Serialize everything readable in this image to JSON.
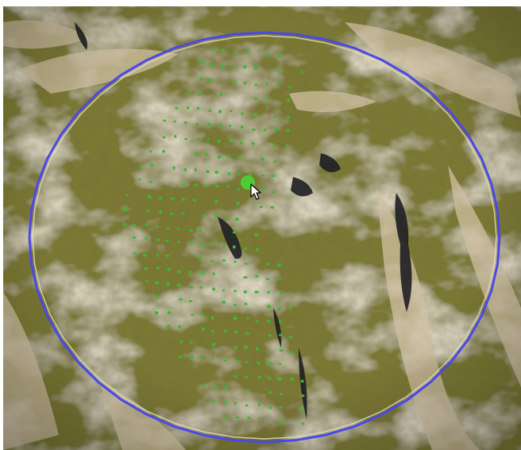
{
  "scene": {
    "view": "editor-3d-viewport",
    "content": "terrain-with-foliage-brush",
    "colors": {
      "grass": "#7d7a32",
      "grass_dark": "#5a5a22",
      "rock_light": "#c9b89c",
      "rock_dark": "#1c1c20",
      "brush_outer": "#4a48e8",
      "brush_inner": "#e6dcb4",
      "foliage_marker": "#3fb53a",
      "brush_center": "#4ccc36"
    },
    "icons": {
      "cursor": "mouse-pointer-icon",
      "brush_center": "brush-center-dot-icon"
    }
  }
}
